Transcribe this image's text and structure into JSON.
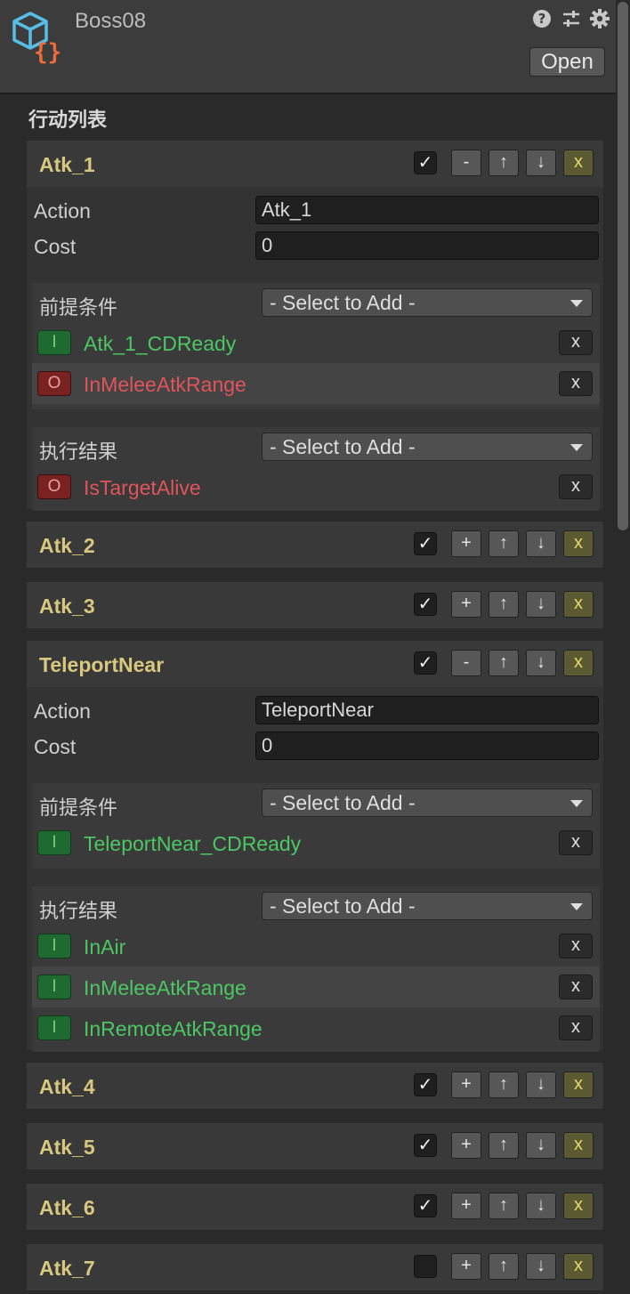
{
  "header": {
    "title": "Boss08",
    "open_label": "Open",
    "icons": [
      "json-script-icon",
      "help-icon",
      "sliders-icon",
      "gear-icon"
    ]
  },
  "section_title": "行动列表",
  "controls": {
    "check": "✓",
    "collapse": "-",
    "expand": "+",
    "up": "↑",
    "down": "↓",
    "remove": "x"
  },
  "field_labels": {
    "action": "Action",
    "cost": "Cost"
  },
  "group_labels": {
    "pre": "前提条件",
    "effect": "执行结果"
  },
  "dropdown_placeholder": "- Select to Add -",
  "badges": {
    "in": "I",
    "out": "O"
  },
  "actions": [
    {
      "name": "Atk_1",
      "enabled": true,
      "expanded": true,
      "action": "Atk_1",
      "cost": "0",
      "preconditions": [
        {
          "type": "I",
          "name": "Atk_1_CDReady"
        },
        {
          "type": "O",
          "name": "InMeleeAtkRange"
        }
      ],
      "effects": [
        {
          "type": "O",
          "name": "IsTargetAlive"
        }
      ]
    },
    {
      "name": "Atk_2",
      "enabled": true,
      "expanded": false
    },
    {
      "name": "Atk_3",
      "enabled": true,
      "expanded": false
    },
    {
      "name": "TeleportNear",
      "enabled": true,
      "expanded": true,
      "action": "TeleportNear",
      "cost": "0",
      "preconditions": [
        {
          "type": "I",
          "name": "TeleportNear_CDReady"
        }
      ],
      "effects": [
        {
          "type": "I",
          "name": "InAir"
        },
        {
          "type": "I",
          "name": "InMeleeAtkRange"
        },
        {
          "type": "I",
          "name": "InRemoteAtkRange"
        }
      ]
    },
    {
      "name": "Atk_4",
      "enabled": true,
      "expanded": false
    },
    {
      "name": "Atk_5",
      "enabled": true,
      "expanded": false
    },
    {
      "name": "Atk_6",
      "enabled": true,
      "expanded": false
    },
    {
      "name": "Atk_7",
      "enabled": false,
      "expanded": false
    }
  ]
}
